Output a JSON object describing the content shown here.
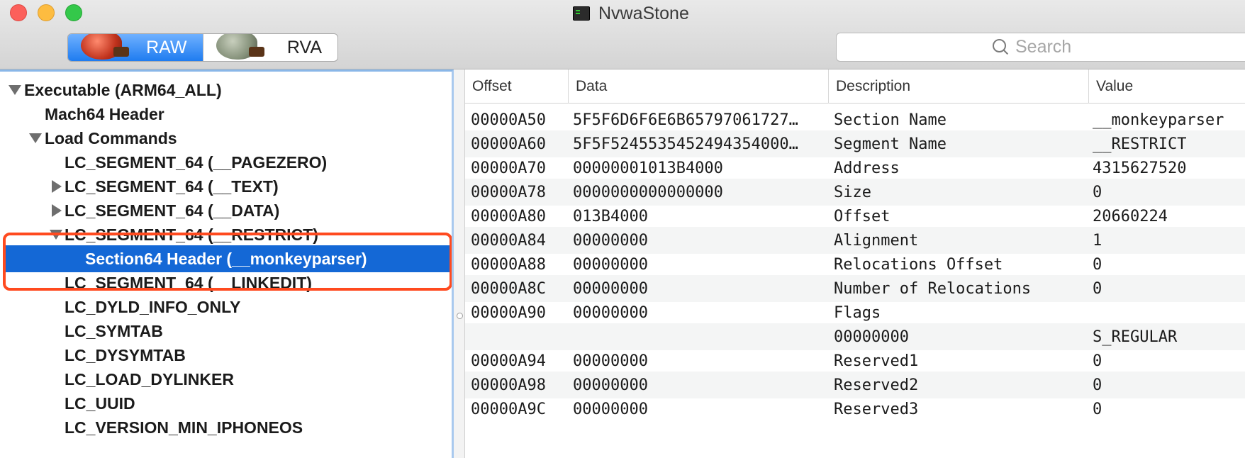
{
  "window": {
    "title": "NvwaStone",
    "app_icon": "terminal-icon"
  },
  "toolbar": {
    "modes": [
      {
        "label": "RAW",
        "icon": "raw-mode-icon",
        "active": true
      },
      {
        "label": "RVA",
        "icon": "rva-mode-icon",
        "active": false
      }
    ],
    "search_placeholder": "Search"
  },
  "tree": {
    "items": [
      {
        "label": "Executable (ARM64_ALL)",
        "disclosure": "expanded",
        "selected": false
      },
      {
        "label": "Mach64 Header",
        "disclosure": "none",
        "selected": false
      },
      {
        "label": "Load Commands",
        "disclosure": "expanded",
        "selected": false
      },
      {
        "label": "LC_SEGMENT_64 (__PAGEZERO)",
        "disclosure": "none",
        "selected": false
      },
      {
        "label": "LC_SEGMENT_64 (__TEXT)",
        "disclosure": "collapsed",
        "selected": false
      },
      {
        "label": "LC_SEGMENT_64 (__DATA)",
        "disclosure": "collapsed",
        "selected": false
      },
      {
        "label": "LC_SEGMENT_64 (__RESTRICT)",
        "disclosure": "expanded",
        "selected": false
      },
      {
        "label": "Section64 Header (__monkeyparser)",
        "disclosure": "none",
        "selected": true
      },
      {
        "label": "LC_SEGMENT_64 (__LINKEDIT)",
        "disclosure": "none",
        "selected": false
      },
      {
        "label": "LC_DYLD_INFO_ONLY",
        "disclosure": "none",
        "selected": false
      },
      {
        "label": "LC_SYMTAB",
        "disclosure": "none",
        "selected": false
      },
      {
        "label": "LC_DYSYMTAB",
        "disclosure": "none",
        "selected": false
      },
      {
        "label": "LC_LOAD_DYLINKER",
        "disclosure": "none",
        "selected": false
      },
      {
        "label": "LC_UUID",
        "disclosure": "none",
        "selected": false
      },
      {
        "label": "LC_VERSION_MIN_IPHONEOS",
        "disclosure": "none",
        "selected": false
      }
    ]
  },
  "table": {
    "columns": [
      "Offset",
      "Data",
      "Description",
      "Value"
    ],
    "rows": [
      [
        "00000A50",
        "5F5F6D6F6E6B65797061727…",
        "Section Name",
        "__monkeyparser"
      ],
      [
        "00000A60",
        "5F5F5245535452494354000…",
        "Segment Name",
        "__RESTRICT"
      ],
      [
        "00000A70",
        "00000001013B4000",
        "Address",
        "4315627520"
      ],
      [
        "00000A78",
        "0000000000000000",
        "Size",
        "0"
      ],
      [
        "00000A80",
        "013B4000",
        "Offset",
        "20660224"
      ],
      [
        "00000A84",
        "00000000",
        "Alignment",
        "1"
      ],
      [
        "00000A88",
        "00000000",
        "Relocations Offset",
        "0"
      ],
      [
        "00000A8C",
        "00000000",
        "Number of Relocations",
        "0"
      ],
      [
        "00000A90",
        "00000000",
        "Flags",
        ""
      ],
      [
        "",
        "",
        "00000000",
        "S_REGULAR"
      ],
      [
        "00000A94",
        "00000000",
        "Reserved1",
        "0"
      ],
      [
        "00000A98",
        "00000000",
        "Reserved2",
        "0"
      ],
      [
        "00000A9C",
        "00000000",
        "Reserved3",
        "0"
      ]
    ]
  },
  "colors": {
    "selection": "#1468d6",
    "annotation_box": "#ff4a1f"
  }
}
